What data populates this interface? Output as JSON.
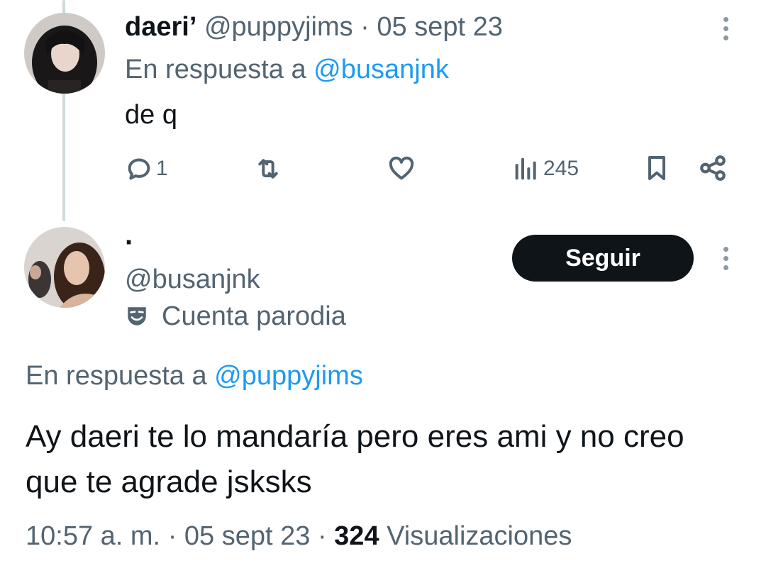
{
  "tweet1": {
    "display_name": "daeri’",
    "handle": "@puppyjims",
    "separator": "·",
    "date": "05 sept 23",
    "reply_prefix": "En respuesta a",
    "reply_to": "@busanjnk",
    "text": "de q",
    "replies": "1",
    "views": "245"
  },
  "tweet2": {
    "display_name": "·",
    "handle": "@busanjnk",
    "parody_label": "Cuenta parodia",
    "follow_label": "Seguir",
    "reply_prefix": "En respuesta a",
    "reply_to": "@puppyjims",
    "text": "Ay daeri te lo mandaría pero eres ami y no creo que te agrade jsksks",
    "time": "10:57 a. m.",
    "separator": "·",
    "date": "05 sept 23",
    "separator2": "·",
    "views_count": "324",
    "views_label": "Visualizaciones"
  },
  "icons": [
    "more-vertical-icon",
    "reply-icon",
    "retweet-icon",
    "like-icon",
    "views-icon",
    "bookmark-icon",
    "share-icon",
    "parody-mask-icon"
  ],
  "colors": {
    "text": "#0f1419",
    "muted": "#536471",
    "link": "#1d9bf0",
    "button": "#0f1419",
    "thread_line": "#cfd9de"
  }
}
